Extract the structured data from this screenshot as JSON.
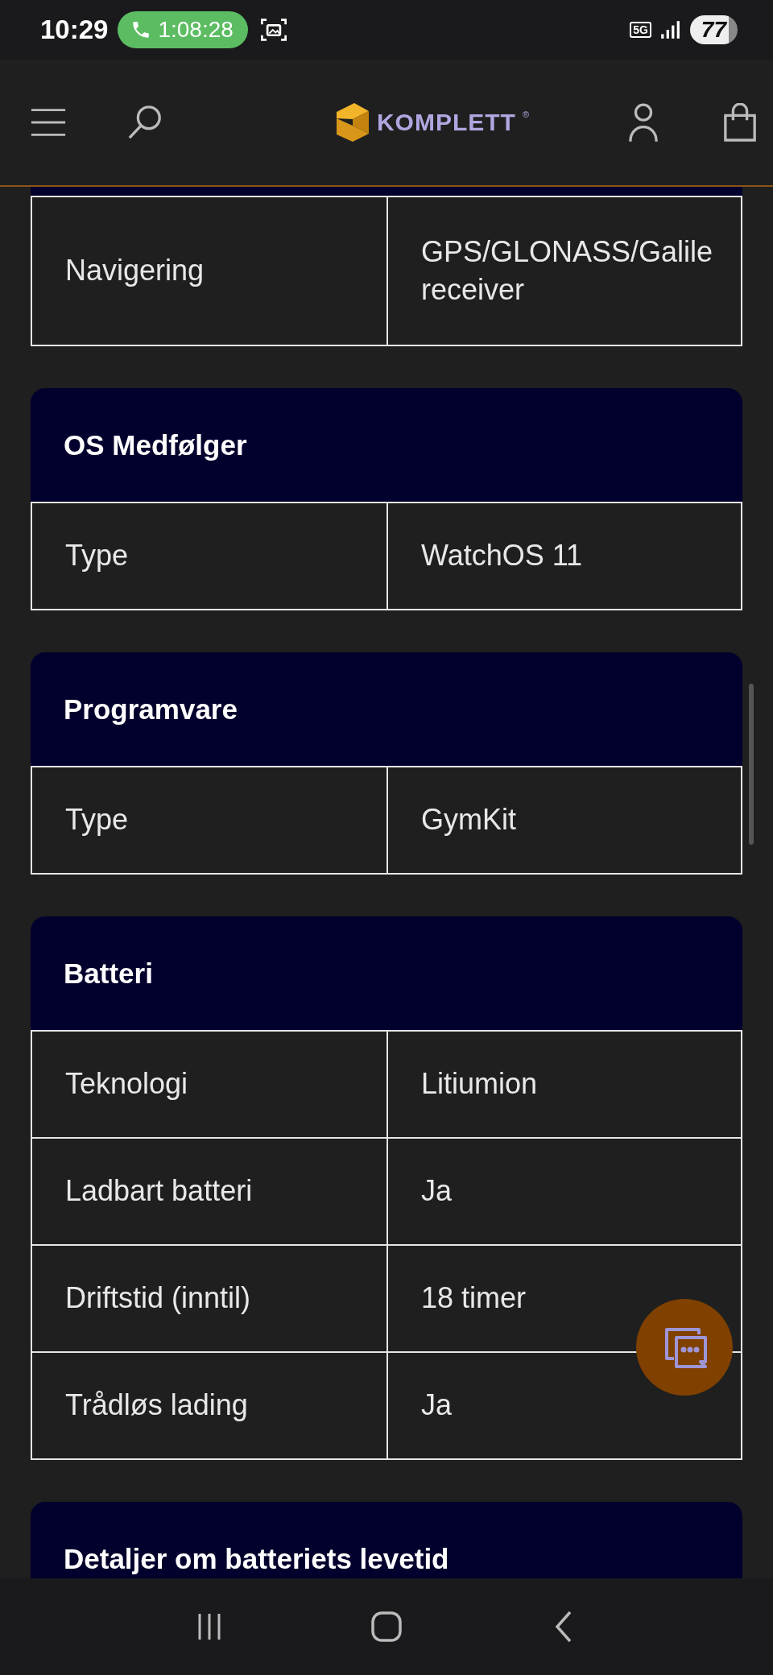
{
  "status_bar": {
    "time": "10:29",
    "call_timer": "1:08:28",
    "network": "5G",
    "battery": "77"
  },
  "header": {
    "logo_text": "KOMPLETT",
    "logo_mark": "®"
  },
  "sections": [
    {
      "rows": [
        {
          "label": "Navigering",
          "value": "GPS/GLONASS/Galile\nreceiver"
        }
      ]
    },
    {
      "title": "OS Medfølger",
      "rows": [
        {
          "label": "Type",
          "value": "WatchOS 11"
        }
      ]
    },
    {
      "title": "Programvare",
      "rows": [
        {
          "label": "Type",
          "value": "GymKit"
        }
      ]
    },
    {
      "title": "Batteri",
      "rows": [
        {
          "label": "Teknologi",
          "value": "Litiumion"
        },
        {
          "label": "Ladbart batteri",
          "value": "Ja"
        },
        {
          "label": "Driftstid (inntil)",
          "value": "18 timer"
        },
        {
          "label": "Trådløs lading",
          "value": "Ja"
        }
      ]
    },
    {
      "title": "Detaljer om batteriets levetid"
    }
  ]
}
